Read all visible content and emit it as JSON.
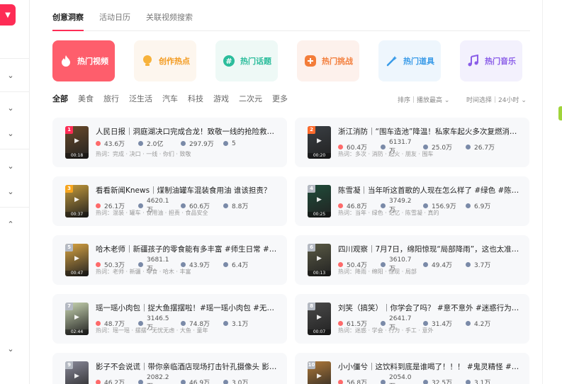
{
  "tabs": [
    {
      "label": "创意洞察",
      "active": true
    },
    {
      "label": "活动日历",
      "active": false
    },
    {
      "label": "关联视频搜索",
      "active": false
    }
  ],
  "categories": [
    {
      "label": "热门视频",
      "icon": "flame-icon"
    },
    {
      "label": "创作热点",
      "icon": "bulb-icon"
    },
    {
      "label": "热门话题",
      "icon": "hashtag-icon"
    },
    {
      "label": "热门挑战",
      "icon": "challenge-icon"
    },
    {
      "label": "热门道具",
      "icon": "magic-wand-icon"
    },
    {
      "label": "热门音乐",
      "icon": "music-note-icon"
    }
  ],
  "filters": [
    "全部",
    "美食",
    "旅行",
    "泛生活",
    "汽车",
    "科技",
    "游戏",
    "二次元",
    "更多"
  ],
  "sort": "排序｜播放最高",
  "time": "时间选择｜24小时",
  "cards": [
    {
      "rank": "1",
      "duration": "00:18",
      "title": "人民日报｜洞庭湖决口完成合龙！致敬一线的抢险救援人员",
      "likes": "43.6万",
      "plays": "2.0亿",
      "comments": "297.9万",
      "shares": "5",
      "tags": "热词：完成 · 决口 · 一线 · 你们 · 致敬",
      "color": "#6a4a2a"
    },
    {
      "rank": "2",
      "duration": "00:20",
      "title": "浙江消防｜“围车造池”降温！私家车起火多次复燃消防员这样处置",
      "likes": "60.4万",
      "plays": "6131.7万",
      "comments": "25.0万",
      "shares": "26.7万",
      "tags": "热词：多次 · 消防 · 起火 · 朋友 · 围车",
      "color": "#3a3f44"
    },
    {
      "rank": "3",
      "duration": "00:37",
      "title": "看看新闻Knews｜煤制油罐车混装食用油 谁该担责？",
      "likes": "26.1万",
      "plays": "4620.1万",
      "comments": "60.6万",
      "shares": "8.8万",
      "tags": "热词：混装 · 罐车 · 食用油 · 担责 · 食品安全",
      "color": "#c49a3a"
    },
    {
      "rank": "4",
      "duration": "00:25",
      "title": "陈雪凝｜当年听这首歌的人现在怎么样了 #绿色 #陈雪凝",
      "likes": "46.8万",
      "plays": "3749.2万",
      "comments": "156.9万",
      "shares": "6.9万",
      "tags": "热词：当年 · 绿色 · 记忆 · 陈雪凝 · 真的",
      "color": "#1f4d3a"
    },
    {
      "rank": "5",
      "duration": "00:47",
      "title": "哈木老师｜新疆孩子的零食能有多丰富 #师生日常 #新疆",
      "likes": "50.3万",
      "plays": "3681.1万",
      "comments": "43.9万",
      "shares": "6.4万",
      "tags": "热词：老师 · 新疆 · 零食 · 哈木 · 丰富",
      "color": "#d9a441"
    },
    {
      "rank": "6",
      "duration": "00:13",
      "title": "四川观察｜7月7日，绵阳惊现“局部降雨”，这也太准了吧",
      "likes": "50.4万",
      "plays": "3610.7万",
      "comments": "49.4万",
      "shares": "3.7万",
      "tags": "热词：降雨 · 绵阳 · 惊现 · 局部",
      "color": "#5a5a45"
    },
    {
      "rank": "7",
      "duration": "02:44",
      "title": "瑶一瑶小肉包｜捉大鱼摆摆啦！#瑶一瑶小肉包 #无忧无虑",
      "likes": "48.7万",
      "plays": "3146.5万",
      "comments": "74.8万",
      "shares": "3.1万",
      "tags": "热词：瑶一瑶 · 摆摆 · 无忧无虑 · 大鱼 · 童年",
      "color": "#c9d6b2"
    },
    {
      "rank": "8",
      "duration": "00:07",
      "title": "刘笑（搞笑）｜你学会了吗？ #意不意外 #迷惑行为大赏",
      "likes": "61.5万",
      "plays": "2641.7万",
      "comments": "31.4万",
      "shares": "4.2万",
      "tags": "热词：迷惑 · 学会 · 行为 · 手工 · 意外",
      "color": "#4a4a4a"
    },
    {
      "rank": "9",
      "duration": "",
      "title": "影子不会说谎｜带你亲临酒店现场打击针孔摄像头 影子不会说谎",
      "likes": "46.2万",
      "plays": "2082.2万",
      "comments": "46.9万",
      "shares": "3.0万",
      "tags": "",
      "color": "#8a8a9a"
    },
    {
      "rank": "10",
      "duration": "",
      "title": "小小僵兮｜这饮料到底是谁喝了！！！ #鬼灵精怪 #萌娃",
      "likes": "56.8万",
      "plays": "2054.0万",
      "comments": "32.5万",
      "shares": "3.1万",
      "tags": "",
      "color": "#b07a3a"
    }
  ],
  "colors": {
    "accent": "#fe2c55",
    "like_dot": "#fe6a6a",
    "play_dot": "#7a8aa8"
  }
}
